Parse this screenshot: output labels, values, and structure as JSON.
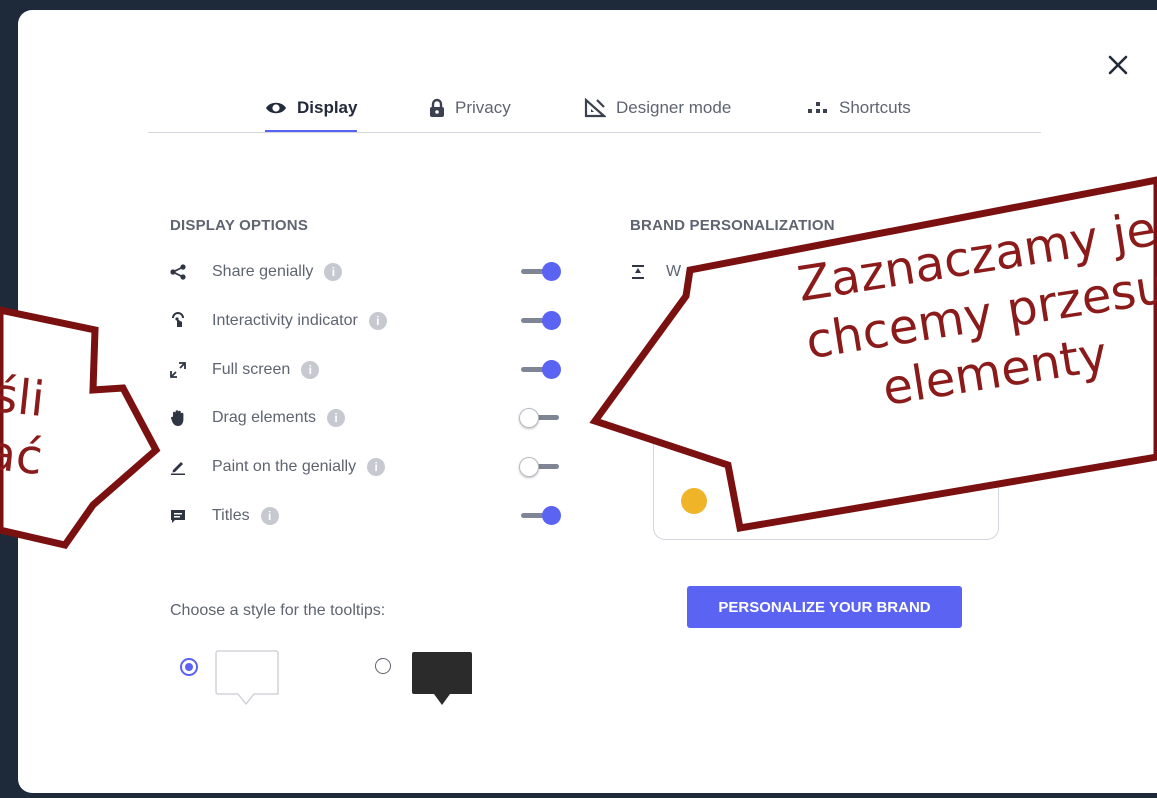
{
  "tabs": [
    {
      "label": "Display",
      "icon": "eye-icon",
      "active": true
    },
    {
      "label": "Privacy",
      "icon": "lock-icon",
      "active": false
    },
    {
      "label": "Designer mode",
      "icon": "set-square-icon",
      "active": false
    },
    {
      "label": "Shortcuts",
      "icon": "shortcuts-icon",
      "active": false
    }
  ],
  "display_options": {
    "title": "DISPLAY OPTIONS",
    "items": [
      {
        "label": "Share genially",
        "icon": "share-icon",
        "enabled": true
      },
      {
        "label": "Interactivity indicator",
        "icon": "tap-icon",
        "enabled": true
      },
      {
        "label": "Full screen",
        "icon": "fullscreen-icon",
        "enabled": true
      },
      {
        "label": "Drag elements",
        "icon": "hand-icon",
        "enabled": false
      },
      {
        "label": "Paint on the genially",
        "icon": "pencil-icon",
        "enabled": false
      },
      {
        "label": "Titles",
        "icon": "comment-icon",
        "enabled": true
      }
    ]
  },
  "tooltips": {
    "label": "Choose a style for the tooltips:",
    "selected": "light",
    "options": [
      "light",
      "dark"
    ]
  },
  "brand": {
    "title": "BRAND PERSONALIZATION",
    "item_label": "W",
    "button_label": "PERSONALIZE YOUR BRAND"
  },
  "callouts": {
    "right_lines": [
      "Zaznaczamy je",
      "chcemy przesu",
      "elementy"
    ],
    "left_lines": [
      "śli",
      "ać"
    ]
  },
  "colors": {
    "accent": "#5b63f2",
    "callout_border": "#7a1010",
    "brand_dot": "#f0b429"
  }
}
